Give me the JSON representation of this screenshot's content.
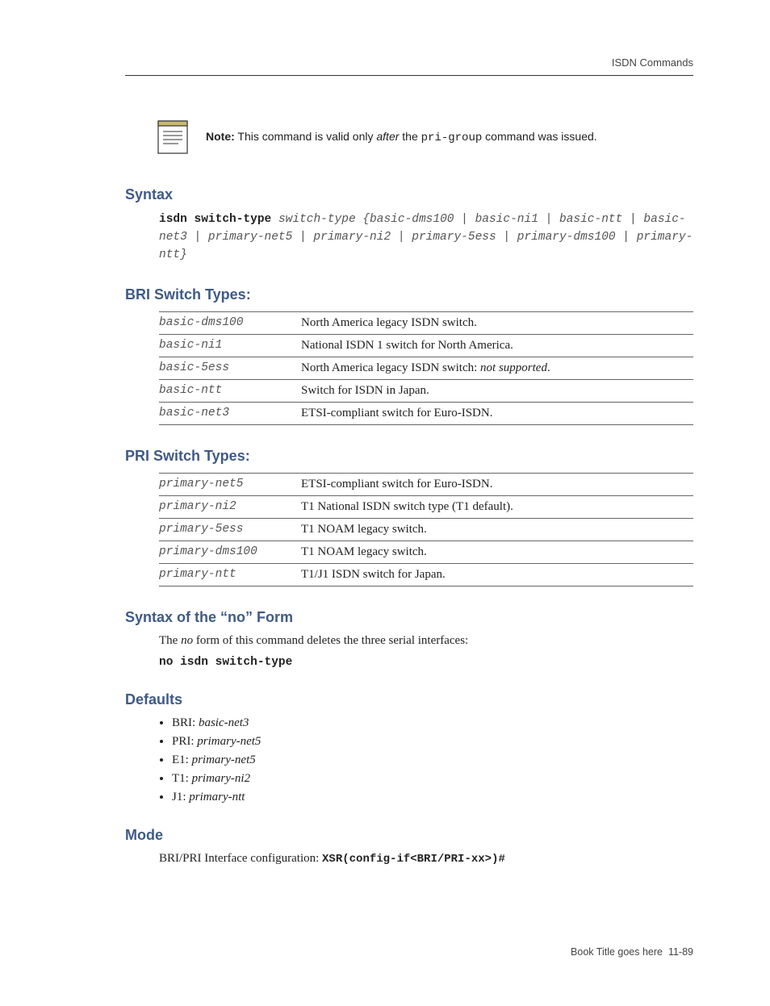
{
  "header": {
    "category": "ISDN Commands"
  },
  "note": {
    "label": "Note:",
    "pre": " This command is valid only ",
    "ital": "after",
    "mid": " the ",
    "mono": "pri-group",
    "post": " command was issued."
  },
  "syntax": {
    "heading": "Syntax",
    "bold": "isdn switch-type ",
    "rest": "switch-type {basic-dms100 | basic-ni1 | basic-ntt | basic-net3 | primary-net5 | primary-ni2 | primary-5ess | primary-dms100 | primary-ntt}"
  },
  "bri": {
    "heading": "BRI Switch Types:",
    "rows": [
      {
        "code": "basic-dms100",
        "desc": "North America legacy ISDN switch."
      },
      {
        "code": "basic-ni1",
        "desc": "National ISDN 1 switch for North America."
      },
      {
        "code": "basic-5ess",
        "descPre": "North America legacy ISDN switch: ",
        "descItal": "not supported",
        "descPost": "."
      },
      {
        "code": "basic-ntt",
        "desc": "Switch for ISDN in Japan."
      },
      {
        "code": "basic-net3",
        "desc": "ETSI-compliant switch for Euro-ISDN."
      }
    ]
  },
  "pri": {
    "heading": "PRI Switch Types:",
    "rows": [
      {
        "code": "primary-net5",
        "desc": "ETSI-compliant switch for Euro-ISDN."
      },
      {
        "code": "primary-ni2",
        "desc": "T1 National ISDN switch type (T1 default)."
      },
      {
        "code": "primary-5ess",
        "desc": "T1 NOAM legacy switch."
      },
      {
        "code": "primary-dms100",
        "desc": "T1 NOAM legacy switch."
      },
      {
        "code": "primary-ntt",
        "desc": "T1/J1 ISDN switch for Japan."
      }
    ]
  },
  "noform": {
    "heading": "Syntax of the “no” Form",
    "textPre": "The ",
    "textItal": "no",
    "textPost": " form of this command deletes the three serial interfaces:",
    "command": "no isdn switch-type"
  },
  "defaults": {
    "heading": "Defaults",
    "items": [
      {
        "label": "BRI: ",
        "value": "basic-net3"
      },
      {
        "label": "PRI: ",
        "value": "primary-net5"
      },
      {
        "label": "E1: ",
        "value": "primary-net5"
      },
      {
        "label": "T1: ",
        "value": "primary-ni2"
      },
      {
        "label": "J1: ",
        "value": "primary-ntt"
      }
    ]
  },
  "mode": {
    "heading": "Mode",
    "text": "BRI/PRI Interface configuration: ",
    "mono": "XSR(config-if<BRI/PRI-xx>)#"
  },
  "footer": {
    "title": "Book Title goes here",
    "page": "11-89"
  }
}
